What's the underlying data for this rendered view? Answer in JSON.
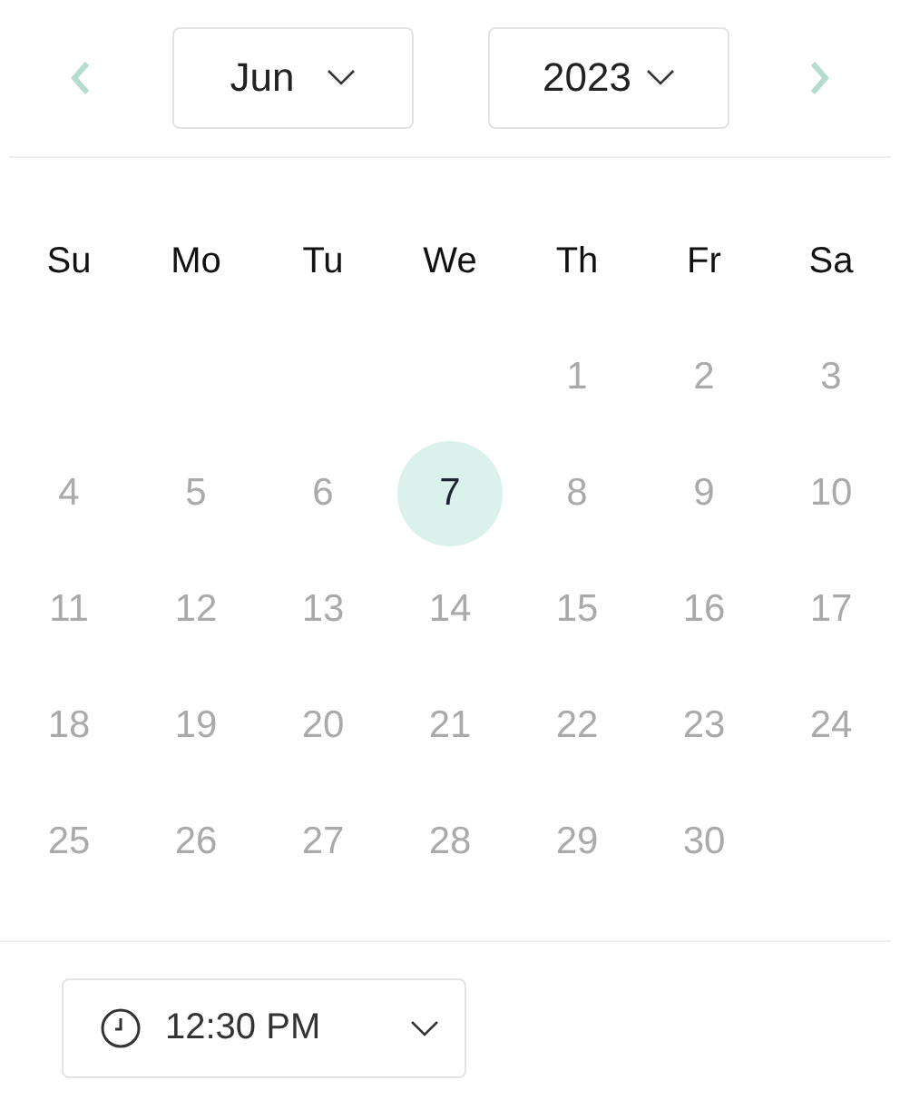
{
  "navigation": {
    "prev": {
      "disabled": false
    },
    "next": {
      "disabled": false
    },
    "month": "Jun",
    "year": "2023"
  },
  "weekdays": [
    "Su",
    "Mo",
    "Tu",
    "We",
    "Th",
    "Fr",
    "Sa"
  ],
  "weeks": [
    [
      {
        "kind": "blank"
      },
      {
        "kind": "blank"
      },
      {
        "kind": "blank"
      },
      {
        "kind": "blank"
      },
      {
        "kind": "day",
        "day": "1",
        "selected": false
      },
      {
        "kind": "day",
        "day": "2",
        "selected": false
      },
      {
        "kind": "day",
        "day": "3",
        "selected": false
      }
    ],
    [
      {
        "kind": "day",
        "day": "4",
        "selected": false
      },
      {
        "kind": "day",
        "day": "5",
        "selected": false
      },
      {
        "kind": "day",
        "day": "6",
        "selected": false
      },
      {
        "kind": "day",
        "day": "7",
        "selected": true
      },
      {
        "kind": "day",
        "day": "8",
        "selected": false
      },
      {
        "kind": "day",
        "day": "9",
        "selected": false
      },
      {
        "kind": "day",
        "day": "10",
        "selected": false
      }
    ],
    [
      {
        "kind": "day",
        "day": "11",
        "selected": false
      },
      {
        "kind": "day",
        "day": "12",
        "selected": false
      },
      {
        "kind": "day",
        "day": "13",
        "selected": false
      },
      {
        "kind": "day",
        "day": "14",
        "selected": false
      },
      {
        "kind": "day",
        "day": "15",
        "selected": false
      },
      {
        "kind": "day",
        "day": "16",
        "selected": false
      },
      {
        "kind": "day",
        "day": "17",
        "selected": false
      }
    ],
    [
      {
        "kind": "day",
        "day": "18",
        "selected": false
      },
      {
        "kind": "day",
        "day": "19",
        "selected": false
      },
      {
        "kind": "day",
        "day": "20",
        "selected": false
      },
      {
        "kind": "day",
        "day": "21",
        "selected": false
      },
      {
        "kind": "day",
        "day": "22",
        "selected": false
      },
      {
        "kind": "day",
        "day": "23",
        "selected": false
      },
      {
        "kind": "day",
        "day": "24",
        "selected": false
      }
    ],
    [
      {
        "kind": "day",
        "day": "25",
        "selected": false
      },
      {
        "kind": "day",
        "day": "26",
        "selected": false
      },
      {
        "kind": "day",
        "day": "27",
        "selected": false
      },
      {
        "kind": "day",
        "day": "28",
        "selected": false
      },
      {
        "kind": "day",
        "day": "29",
        "selected": false
      },
      {
        "kind": "day",
        "day": "30",
        "selected": false
      },
      {
        "kind": "blank"
      }
    ]
  ],
  "time": {
    "value": "12:30 PM"
  }
}
